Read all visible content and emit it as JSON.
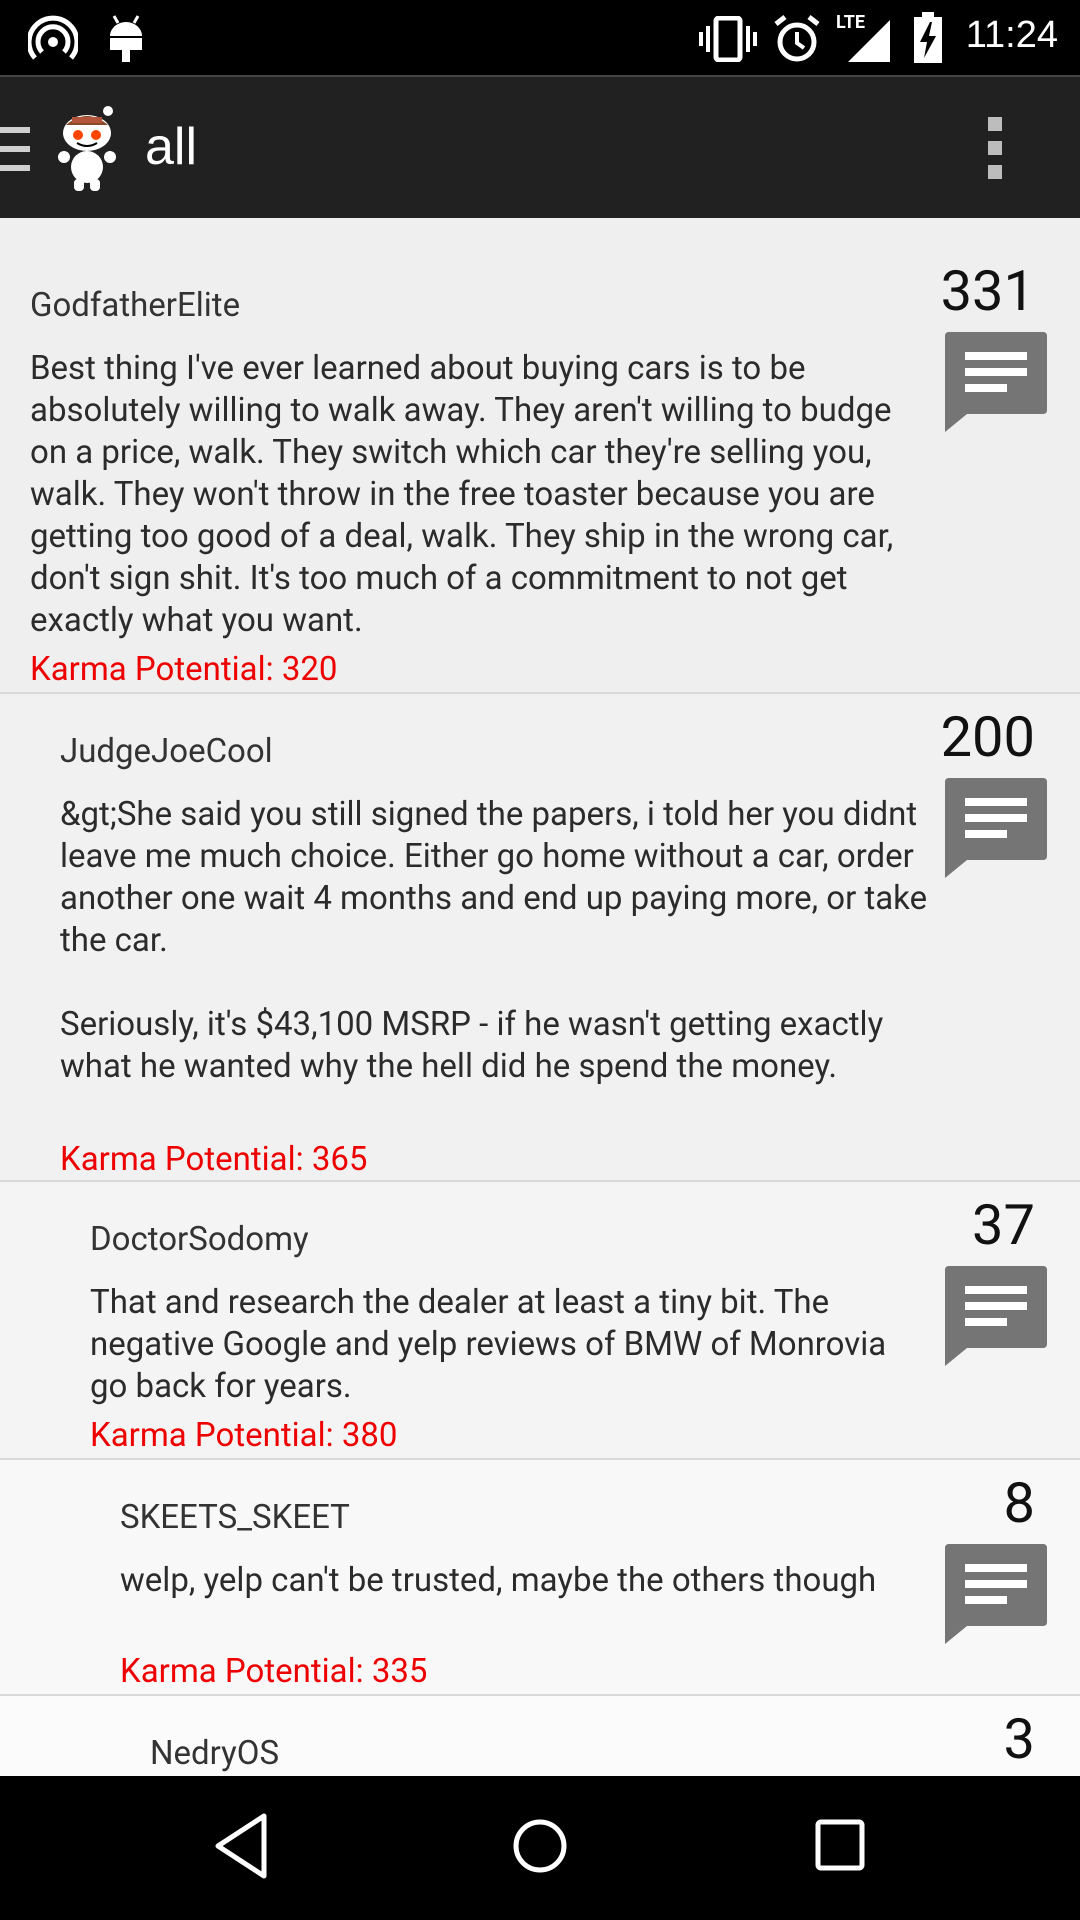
{
  "status_bar": {
    "time": "11:24",
    "icons": [
      "hotspot-icon",
      "android-icon",
      "vibrate-icon",
      "alarm-icon",
      "lte-signal-icon",
      "battery-charging-icon"
    ],
    "network_label": "LTE"
  },
  "app_bar": {
    "title": "all",
    "icons": [
      "menu-icon",
      "reddit-logo-icon",
      "overflow-menu-icon"
    ]
  },
  "colors": {
    "karma": "#ee0000",
    "app_bar": "#212121",
    "comment_icon": "#757575"
  },
  "comments": [
    {
      "author": "GodfatherElite",
      "score": "331",
      "body": "Best thing I've ever learned about buying cars is to be absolutely willing to walk away. They aren't willing to budge on a price, walk. They switch which car they're selling you, walk. They won't throw in the free toaster because you are getting too good of a deal, walk. They ship in the wrong car, don't sign shit. It's too much of a commitment to not get exactly what you want.",
      "karma": "Karma Potential: 320"
    },
    {
      "author": "JudgeJoeCool",
      "score": "200",
      "body": "&gt;She said you still signed the papers, i told her you didnt leave me much choice. Either go home without a car, order another one wait 4 months and end up paying more, or take the car.\n\nSeriously, it's $43,100 MSRP - if he wasn't getting exactly what he wanted  why the hell did he spend the money.",
      "karma": "Karma Potential: 365"
    },
    {
      "author": "DoctorSodomy",
      "score": "37",
      "body": "That and research the dealer at least a tiny bit.  The negative Google and yelp reviews of BMW of Monrovia go back for years.",
      "karma": "Karma Potential: 380"
    },
    {
      "author": "SKEETS_SKEET",
      "score": "8",
      "body": "welp, yelp can't be trusted, maybe the others though",
      "karma": "Karma Potential: 335"
    },
    {
      "author": "NedryOS",
      "score": "3"
    }
  ],
  "nav_bar": {
    "icons": [
      "back-icon",
      "home-icon",
      "recents-icon"
    ]
  }
}
